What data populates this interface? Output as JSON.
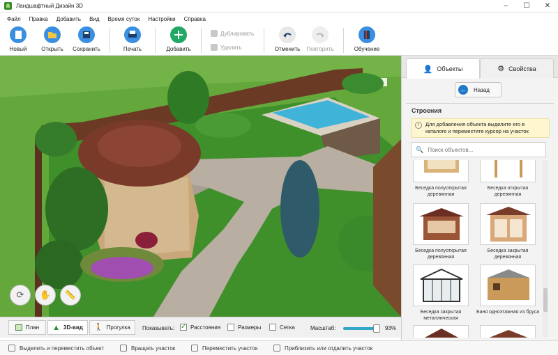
{
  "window": {
    "title": "Ландшафтный Дизайн 3D",
    "controls": [
      "–",
      "☐",
      "✕"
    ]
  },
  "menu": [
    "Файл",
    "Правка",
    "Добавить",
    "Вид",
    "Время суток",
    "Настройки",
    "Справка"
  ],
  "toolbar": {
    "new": "Новый",
    "open": "Открыть",
    "save": "Сохранить",
    "print": "Печать",
    "add": "Добавить",
    "duplicate": "Дублировать",
    "delete": "Удалить",
    "undo": "Отменить",
    "redo": "Повторить",
    "learn": "Обучение"
  },
  "panel": {
    "tab_objects": "Объекты",
    "tab_properties": "Свойства",
    "back": "Назад",
    "section": "Строения",
    "hint": "Для добавления объекта выделите его в каталоге и переместите курсор на участок",
    "search_placeholder": "Поиск объектов...",
    "items": [
      "Беседка полуоткрытая деревянная",
      "Беседка открытая деревянная",
      "Беседка полуоткрытая деревянная",
      "Беседка закрытая деревянная",
      "Беседка закрытая металлическая",
      "Баня одноэтажная из бруса"
    ]
  },
  "viewbar": {
    "plan": "План",
    "view3d": "3D-вид",
    "walk": "Прогулка",
    "show": "Показывать:",
    "distances": "Расстояния",
    "sizes": "Размеры",
    "grid": "Сетка",
    "scale": "Масштаб:",
    "zoom": "93%",
    "zoom_level": 0.93
  },
  "status": {
    "select": "Выделить и переместить объект",
    "rotate": "Вращать участок",
    "move": "Переместить участок",
    "zoom": "Приблизить или отдалить участок"
  },
  "colors": {
    "accent": "#1f79c9",
    "grass": "#4f9a34",
    "add": "#21a865"
  }
}
